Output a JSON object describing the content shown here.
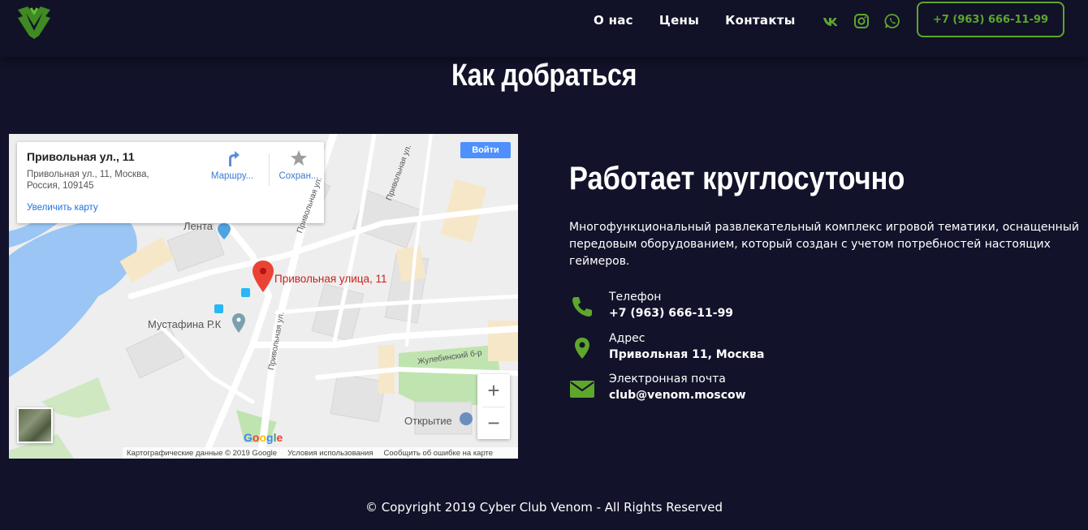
{
  "header": {
    "logo_icon": "venom-claw-logo-icon",
    "nav": [
      "О нас",
      "Цены",
      "Контакты"
    ],
    "social_icons": [
      "vk-icon",
      "instagram-icon",
      "whatsapp-icon"
    ],
    "phone_button": "+7 (963) 666-11-99",
    "accent_color": "#5ea62c"
  },
  "section": {
    "title": "Как добраться"
  },
  "map": {
    "card": {
      "title": "Привольная ул., 11",
      "address": "Привольная ул., 11, Москва, Россия, 109145",
      "enlarge": "Увеличить карту",
      "route": "Маршру...",
      "save": "Сохран..."
    },
    "login": "Войти",
    "pin_label": "Привольная улица, 11",
    "labels": {
      "lenta": "Лента",
      "mustafina": "Мустафина Р.К",
      "street1": "Привольная ул.",
      "street2": "Привольная ул.",
      "street3": "Привольная ул.",
      "zhulebinsky": "Жулебинский б-р",
      "otkrytie": "Открытие"
    },
    "zoom_in": "+",
    "zoom_out": "−",
    "google_logo": "Google",
    "attribution": {
      "data": "Картографические данные © 2019 Google",
      "terms": "Условия использования",
      "report": "Сообщить об ошибке на карте"
    }
  },
  "info": {
    "title": "Работает круглосуточно",
    "description": "Многофункциональный развлекательный комплекс игровой тематики, оснащенный передовым оборудованием, который создан с учетом потребностей настоящих геймеров.",
    "contacts": [
      {
        "icon": "phone-icon",
        "label": "Телефон",
        "value": "+7 (963) 666-11-99"
      },
      {
        "icon": "location-pin-icon",
        "label": "Адрес",
        "value": "Привольная 11, Москва"
      },
      {
        "icon": "envelope-icon",
        "label": "Электронная почта",
        "value": "club@venom.moscow"
      }
    ]
  },
  "footer": {
    "copyright": "© Copyright 2019 Cyber Club Venom - All Rights Reserved"
  }
}
